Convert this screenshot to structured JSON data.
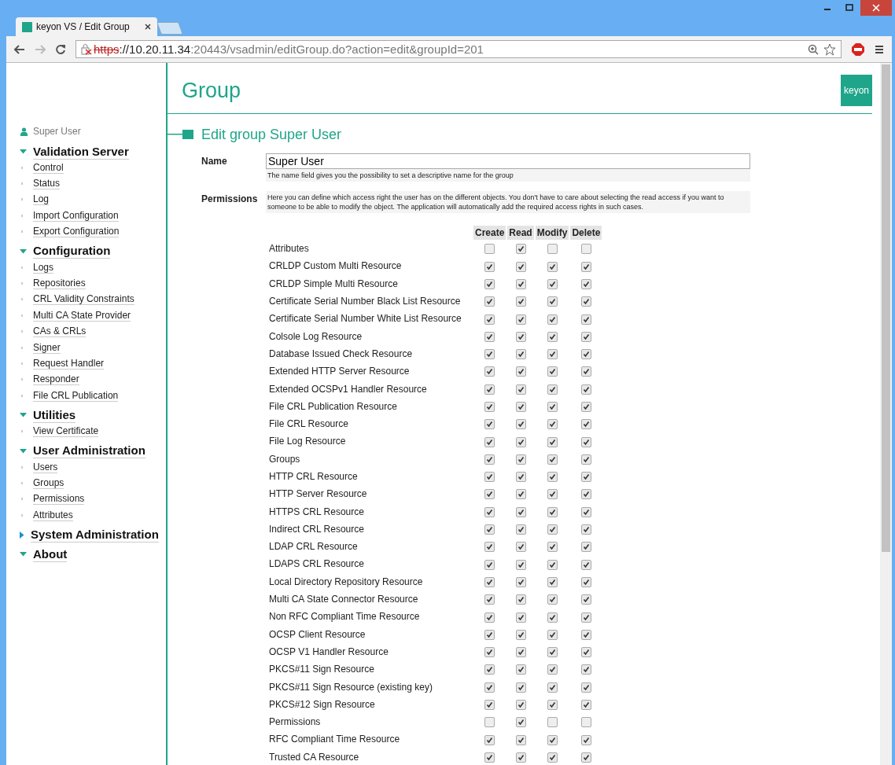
{
  "browser": {
    "tab_title": "keyon VS / Edit Group",
    "url_scheme": "https",
    "url_host": "://10.20.11.34",
    "url_rest": ":20443/vsadmin/editGroup.do?action=edit&groupId=201"
  },
  "sidebar": {
    "user": "Super User",
    "sections": [
      {
        "title": "Validation Server",
        "expanded": true,
        "items": [
          "Control",
          "Status",
          "Log",
          "Import Configuration",
          "Export Configuration"
        ]
      },
      {
        "title": "Configuration",
        "expanded": true,
        "items": [
          "Logs",
          "Repositories",
          "CRL Validity Constraints",
          "Multi CA State Provider",
          "CAs & CRLs",
          "Signer",
          "Request Handler",
          "Responder",
          "File CRL Publication"
        ]
      },
      {
        "title": "Utilities",
        "expanded": true,
        "items": [
          "View Certificate"
        ]
      },
      {
        "title": "User Administration",
        "expanded": true,
        "items": [
          "Users",
          "Groups",
          "Permissions",
          "Attributes"
        ]
      },
      {
        "title": "System Administration",
        "expanded": false
      },
      {
        "title": "About",
        "expanded": true
      }
    ]
  },
  "page": {
    "title": "Group",
    "logo": "keyon",
    "section_title": "Edit group Super User"
  },
  "form": {
    "name_label": "Name",
    "name_value": "Super User",
    "name_help": "The name field gives you the possibility to set a descriptive name for the group",
    "permissions_label": "Permissions",
    "permissions_help": "Here you can define which access right the user has on the different objects. You don't have to care about selecting the read access if you want to someone to be able to modify the object. The application will automatically add the required access rights in such cases."
  },
  "table": {
    "columns": [
      "Create",
      "Read",
      "Modify",
      "Delete"
    ],
    "rows": [
      {
        "label": "Attributes",
        "checks": [
          false,
          true,
          false,
          false
        ]
      },
      {
        "label": "CRLDP Custom Multi Resource",
        "checks": [
          true,
          true,
          true,
          true
        ]
      },
      {
        "label": "CRLDP Simple Multi Resource",
        "checks": [
          true,
          true,
          true,
          true
        ]
      },
      {
        "label": "Certificate Serial Number Black List Resource",
        "checks": [
          true,
          true,
          true,
          true
        ]
      },
      {
        "label": "Certificate Serial Number White List Resource",
        "checks": [
          true,
          true,
          true,
          true
        ]
      },
      {
        "label": "Colsole Log Resource",
        "checks": [
          true,
          true,
          true,
          true
        ]
      },
      {
        "label": "Database Issued Check Resource",
        "checks": [
          true,
          true,
          true,
          true
        ]
      },
      {
        "label": "Extended HTTP Server Resource",
        "checks": [
          true,
          true,
          true,
          true
        ]
      },
      {
        "label": "Extended OCSPv1 Handler Resource",
        "checks": [
          true,
          true,
          true,
          true
        ]
      },
      {
        "label": "File CRL Publication Resource",
        "checks": [
          true,
          true,
          true,
          true
        ]
      },
      {
        "label": "File CRL Resource",
        "checks": [
          true,
          true,
          true,
          true
        ]
      },
      {
        "label": "File Log Resource",
        "checks": [
          true,
          true,
          true,
          true
        ]
      },
      {
        "label": "Groups",
        "checks": [
          true,
          true,
          true,
          true
        ]
      },
      {
        "label": "HTTP CRL Resource",
        "checks": [
          true,
          true,
          true,
          true
        ]
      },
      {
        "label": "HTTP Server Resource",
        "checks": [
          true,
          true,
          true,
          true
        ]
      },
      {
        "label": "HTTPS CRL Resource",
        "checks": [
          true,
          true,
          true,
          true
        ]
      },
      {
        "label": "Indirect CRL Resource",
        "checks": [
          true,
          true,
          true,
          true
        ]
      },
      {
        "label": "LDAP CRL Resource",
        "checks": [
          true,
          true,
          true,
          true
        ]
      },
      {
        "label": "LDAPS CRL Resource",
        "checks": [
          true,
          true,
          true,
          true
        ]
      },
      {
        "label": "Local Directory Repository Resource",
        "checks": [
          true,
          true,
          true,
          true
        ]
      },
      {
        "label": "Multi CA State Connector Resource",
        "checks": [
          true,
          true,
          true,
          true
        ]
      },
      {
        "label": "Non RFC Compliant Time Resource",
        "checks": [
          true,
          true,
          true,
          true
        ]
      },
      {
        "label": "OCSP Client Resource",
        "checks": [
          true,
          true,
          true,
          true
        ]
      },
      {
        "label": "OCSP V1 Handler Resource",
        "checks": [
          true,
          true,
          true,
          true
        ]
      },
      {
        "label": "PKCS#11 Sign Resource",
        "checks": [
          true,
          true,
          true,
          true
        ]
      },
      {
        "label": "PKCS#11 Sign Resource (existing key)",
        "checks": [
          true,
          true,
          true,
          true
        ]
      },
      {
        "label": "PKCS#12 Sign Resource",
        "checks": [
          true,
          true,
          true,
          true
        ]
      },
      {
        "label": "Permissions",
        "checks": [
          false,
          true,
          false,
          false
        ]
      },
      {
        "label": "RFC Compliant Time Resource",
        "checks": [
          true,
          true,
          true,
          true
        ]
      },
      {
        "label": "Trusted CA Resource",
        "checks": [
          true,
          true,
          true,
          true
        ]
      }
    ]
  }
}
